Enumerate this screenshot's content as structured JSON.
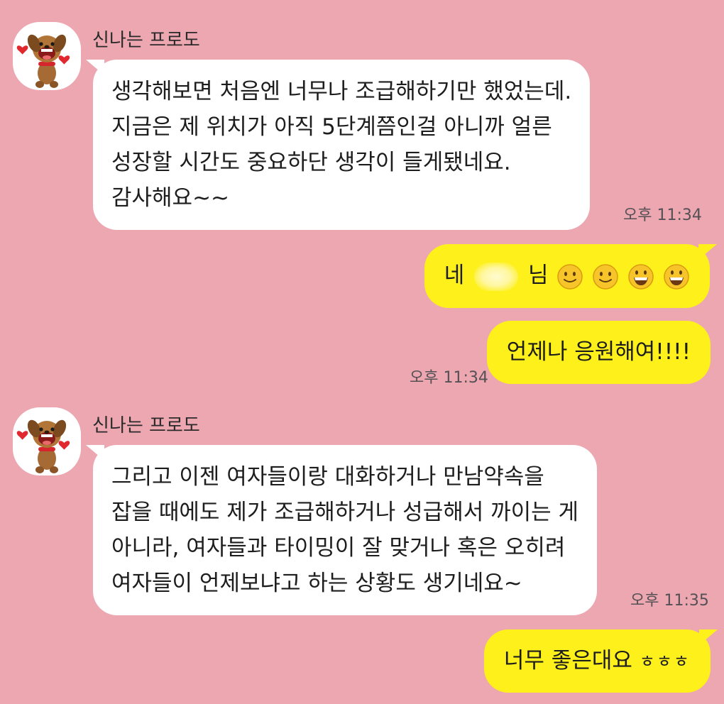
{
  "chat": {
    "messages": [
      {
        "id": "m1",
        "direction": "incoming",
        "sender": "신나는 프로도",
        "lines": [
          "생각해보면 처음엔 너무나 조급해하기만 했었는데.",
          "지금은 제 위치가 아직 5단계쯤인걸 아니까 얼른",
          "성장할 시간도 중요하단 생각이 들게됐네요.",
          "감사해요~~"
        ],
        "time": "오후 11:34"
      },
      {
        "id": "m2",
        "direction": "outgoing",
        "text_before": "네",
        "text_after": "님",
        "redacted": true,
        "emoticons": [
          "slight-smile-icon",
          "slight-smile-icon",
          "grin-icon",
          "grin-icon"
        ]
      },
      {
        "id": "m3",
        "direction": "outgoing",
        "text": "언제나 응원해여!!!!",
        "time": "오후 11:34"
      },
      {
        "id": "m4",
        "direction": "incoming",
        "sender": "신나는 프로도",
        "lines": [
          "그리고 이젠 여자들이랑 대화하거나 만남약속을",
          "잡을 때에도 제가 조급해하거나 성급해서 까이는 게",
          "아니라, 여자들과 타이밍이 잘 맞거나 혹은 오히려",
          "여자들이 언제보냐고 하는 상황도 생기네요~"
        ],
        "time": "오후 11:35"
      },
      {
        "id": "m5",
        "direction": "outgoing",
        "text": "너무 좋은대요",
        "suffix": "ㅎㅎㅎ"
      }
    ]
  },
  "colors": {
    "background": "#eca7b1",
    "incoming_bubble": "#ffffff",
    "outgoing_bubble": "#fef01b",
    "time_text": "#555055"
  }
}
